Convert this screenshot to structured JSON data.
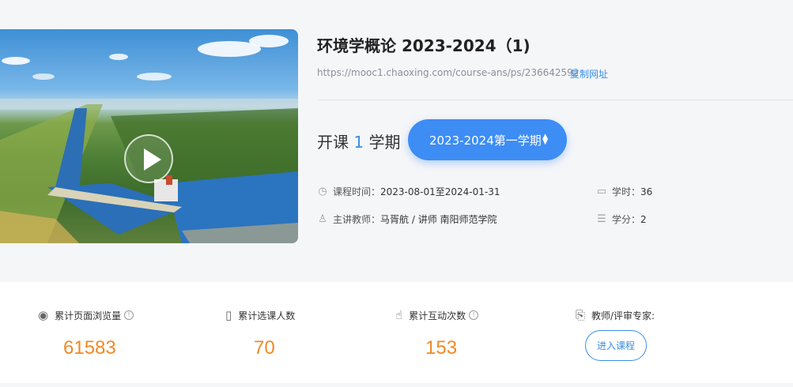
{
  "course": {
    "title": "环境学概论 2023-2024（1)",
    "url": "https://mooc1.chaoxing.com/course-ans/ps/236642592",
    "copy_label": "复制网址"
  },
  "term": {
    "prefix": "开课",
    "count": "1",
    "suffix": "学期",
    "selected": "2023-2024第一学期"
  },
  "meta": {
    "time_label": "课程时间：",
    "time_value": "2023-08-01至2024-01-31",
    "hours_label": "学时：",
    "hours_value": "36",
    "teacher_label": "主讲教师：",
    "teacher_value": "马胥航 / 讲师 南阳师范学院",
    "credits_label": "学分：",
    "credits_value": "2"
  },
  "stats": {
    "views_label": "累计页面浏览量",
    "views_value": "61583",
    "enroll_label": "累计选课人数",
    "enroll_value": "70",
    "interact_label": "累计互动次数",
    "interact_value": "153",
    "expert_label": "教师/评审专家:",
    "enter_label": "进入课程"
  },
  "icons": {
    "play": "play-icon",
    "clock": "clock-icon",
    "calendar": "calendar-icon",
    "user": "user-icon",
    "database": "credits-icon",
    "eye": "eye-icon",
    "book": "book-icon",
    "hand": "touch-icon",
    "expert": "expert-icon",
    "info": "info-icon"
  },
  "colors": {
    "accent": "#3d8df5",
    "stat_value": "#f08a24",
    "link": "#3a8ee6"
  }
}
